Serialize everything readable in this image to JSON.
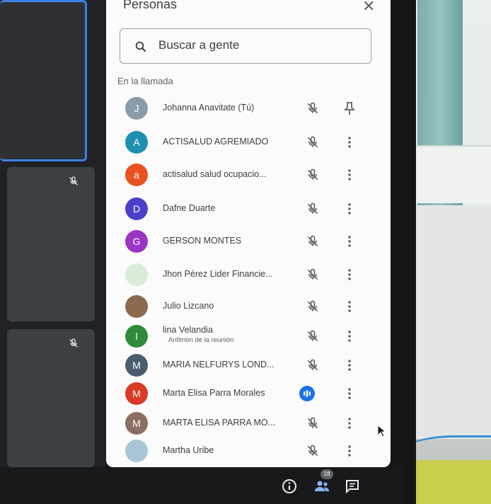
{
  "panel": {
    "title": "Personas",
    "close_icon": "close-icon",
    "search": {
      "placeholder": "Buscar a gente",
      "value": ""
    },
    "section_label": "En la llamada"
  },
  "participants": [
    {
      "name": "Johanna Anavitate (Tú)",
      "initial": "J",
      "color": "#8a9aa8",
      "sublabel": "",
      "action_icon": "pin-icon"
    },
    {
      "name": "ACTISALUD AGREMIADO",
      "initial": "A",
      "color": "#1e8fb0",
      "sublabel": "",
      "action_icon": "more-vert-icon"
    },
    {
      "name": "actisalud salud ocupacio...",
      "initial": "a",
      "color": "#e8521f",
      "sublabel": "",
      "action_icon": "more-vert-icon"
    },
    {
      "name": "Dafne Duarte",
      "initial": "D",
      "color": "#4b3fc9",
      "sublabel": "",
      "action_icon": "more-vert-icon"
    },
    {
      "name": "GERSON MONTES",
      "initial": "G",
      "color": "#9b35c4",
      "sublabel": "",
      "action_icon": "more-vert-icon"
    },
    {
      "name": "Jhon Pérez Lider Financie...",
      "initial": "",
      "color": "#d9ecd9",
      "sublabel": "",
      "action_icon": "more-vert-icon"
    },
    {
      "name": "Julio Lizcano",
      "initial": "",
      "color": "#8a6a50",
      "sublabel": "",
      "action_icon": "more-vert-icon"
    },
    {
      "name": "lina Velandia",
      "initial": "l",
      "color": "#2e8b3a",
      "sublabel": "Anfitrión de la reunión",
      "action_icon": "more-vert-icon"
    },
    {
      "name": "MARIA NELFURYS LOND...",
      "initial": "M",
      "color": "#4a5d6e",
      "sublabel": "",
      "action_icon": "more-vert-icon"
    },
    {
      "name": "Marta Elisa Parra Morales",
      "initial": "M",
      "color": "#d93a25",
      "sublabel": "",
      "action_icon": "more-vert-icon",
      "speaking": true
    },
    {
      "name": "MARTA ELISA PARRA MO...",
      "initial": "M",
      "color": "#8d6e63",
      "sublabel": "",
      "action_icon": "more-vert-icon"
    },
    {
      "name": "Martha Uribe",
      "initial": "",
      "color": "#a9c6d9",
      "sublabel": "",
      "action_icon": "more-vert-icon"
    }
  ],
  "bottom_bar": {
    "info_icon": "info-icon",
    "people_icon": "people-icon",
    "people_count": "18",
    "chat_icon": "chat-icon"
  }
}
